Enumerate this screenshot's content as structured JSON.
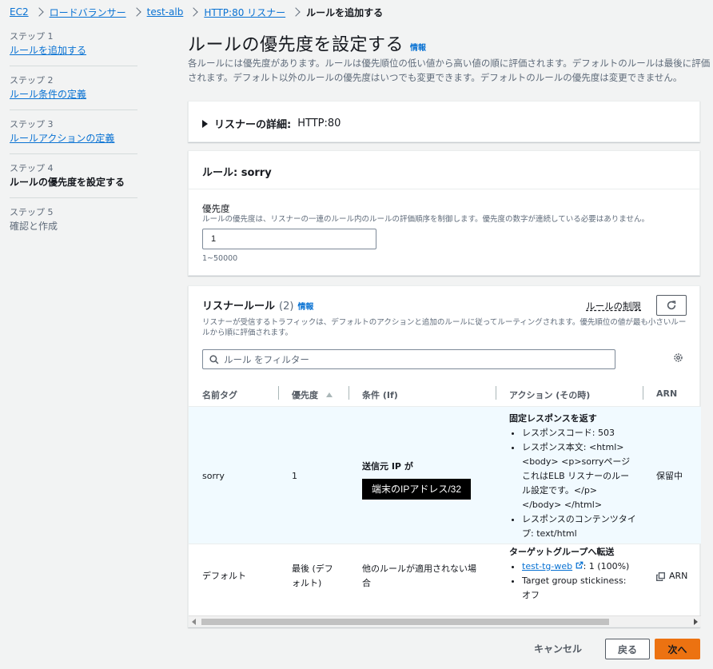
{
  "breadcrumb": {
    "items": [
      "EC2",
      "ロードバランサー",
      "test-alb",
      "HTTP:80 リスナー"
    ],
    "current": "ルールを追加する"
  },
  "steps": [
    {
      "num": "ステップ 1",
      "label": "ルールを追加する"
    },
    {
      "num": "ステップ 2",
      "label": "ルール条件の定義"
    },
    {
      "num": "ステップ 3",
      "label": "ルールアクションの定義"
    },
    {
      "num": "ステップ 4",
      "label": "ルールの優先度を設定する"
    },
    {
      "num": "ステップ 5",
      "label": "確認と作成"
    }
  ],
  "page": {
    "title": "ルールの優先度を設定する",
    "info": "情報",
    "description": "各ルールには優先度があります。ルールは優先順位の低い値から高い値の順に評価されます。デフォルトのルールは最後に評価されます。デフォルト以外のルールの優先度はいつでも変更できます。デフォルトのルールの優先度は変更できません。"
  },
  "listener": {
    "label": "リスナーの詳細:",
    "value": "HTTP:80"
  },
  "rule": {
    "header": "ルール: sorry",
    "priority_label": "優先度",
    "priority_desc": "ルールの優先度は、リスナーの一連のルール内のルールの評価順序を制御します。優先度の数字が連続している必要はありません。",
    "priority_value": "1",
    "priority_hint": "1~50000"
  },
  "listener_rules": {
    "title": "リスナールール",
    "count": "(2)",
    "info": "情報",
    "limit_link": "ルールの制限",
    "description": "リスナーが受信するトラフィックは、デフォルトのアクションと追加のルールに従ってルーティングされます。優先順位の値が最も小さいルールから順に評価されます。",
    "filter_placeholder": "ルール をフィルター",
    "columns": [
      "名前タグ",
      "優先度",
      "条件 (If)",
      "アクション (その時)",
      "ARN"
    ],
    "rows": [
      {
        "name": "sorry",
        "priority": "1",
        "condition_label": "送信元 IP が",
        "condition_value": "端末のIPアドレス/32",
        "action_title": "固定レスポンスを返す",
        "action_items": [
          "レスポンスコード: 503",
          "レスポンス本文: <html> <body> <p>sorryページ これはELB リスナーのルール設定です。</p> </body> </html>",
          "レスポンスのコンテンツタイプ: text/html"
        ],
        "arn": "保留中"
      },
      {
        "name": "デフォルト",
        "priority": "最後 (デフォルト)",
        "condition": "他のルールが適用されない場合",
        "action_title": "ターゲットグループへ転送",
        "tg_link": "test-tg-web",
        "tg_weight": ": 1 (100%)",
        "stickiness": "Target group stickiness: オフ",
        "arn": "ARN"
      }
    ]
  },
  "footer": {
    "cancel": "キャンセル",
    "back": "戻る",
    "next": "次へ"
  },
  "colors": {
    "accent": "#ec7211",
    "link": "#0972d3",
    "selected_row": "#f1faff"
  }
}
